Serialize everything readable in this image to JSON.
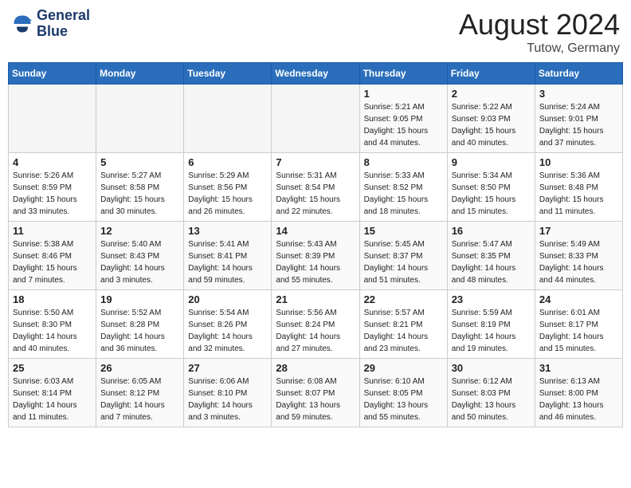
{
  "header": {
    "logo_line1": "General",
    "logo_line2": "Blue",
    "title": "August 2024",
    "subtitle": "Tutow, Germany"
  },
  "days_of_week": [
    "Sunday",
    "Monday",
    "Tuesday",
    "Wednesday",
    "Thursday",
    "Friday",
    "Saturday"
  ],
  "weeks": [
    [
      {
        "day": "",
        "sunrise": "",
        "sunset": "",
        "daylight": ""
      },
      {
        "day": "",
        "sunrise": "",
        "sunset": "",
        "daylight": ""
      },
      {
        "day": "",
        "sunrise": "",
        "sunset": "",
        "daylight": ""
      },
      {
        "day": "",
        "sunrise": "",
        "sunset": "",
        "daylight": ""
      },
      {
        "day": "1",
        "sunrise": "Sunrise: 5:21 AM",
        "sunset": "Sunset: 9:05 PM",
        "daylight": "Daylight: 15 hours and 44 minutes."
      },
      {
        "day": "2",
        "sunrise": "Sunrise: 5:22 AM",
        "sunset": "Sunset: 9:03 PM",
        "daylight": "Daylight: 15 hours and 40 minutes."
      },
      {
        "day": "3",
        "sunrise": "Sunrise: 5:24 AM",
        "sunset": "Sunset: 9:01 PM",
        "daylight": "Daylight: 15 hours and 37 minutes."
      }
    ],
    [
      {
        "day": "4",
        "sunrise": "Sunrise: 5:26 AM",
        "sunset": "Sunset: 8:59 PM",
        "daylight": "Daylight: 15 hours and 33 minutes."
      },
      {
        "day": "5",
        "sunrise": "Sunrise: 5:27 AM",
        "sunset": "Sunset: 8:58 PM",
        "daylight": "Daylight: 15 hours and 30 minutes."
      },
      {
        "day": "6",
        "sunrise": "Sunrise: 5:29 AM",
        "sunset": "Sunset: 8:56 PM",
        "daylight": "Daylight: 15 hours and 26 minutes."
      },
      {
        "day": "7",
        "sunrise": "Sunrise: 5:31 AM",
        "sunset": "Sunset: 8:54 PM",
        "daylight": "Daylight: 15 hours and 22 minutes."
      },
      {
        "day": "8",
        "sunrise": "Sunrise: 5:33 AM",
        "sunset": "Sunset: 8:52 PM",
        "daylight": "Daylight: 15 hours and 18 minutes."
      },
      {
        "day": "9",
        "sunrise": "Sunrise: 5:34 AM",
        "sunset": "Sunset: 8:50 PM",
        "daylight": "Daylight: 15 hours and 15 minutes."
      },
      {
        "day": "10",
        "sunrise": "Sunrise: 5:36 AM",
        "sunset": "Sunset: 8:48 PM",
        "daylight": "Daylight: 15 hours and 11 minutes."
      }
    ],
    [
      {
        "day": "11",
        "sunrise": "Sunrise: 5:38 AM",
        "sunset": "Sunset: 8:46 PM",
        "daylight": "Daylight: 15 hours and 7 minutes."
      },
      {
        "day": "12",
        "sunrise": "Sunrise: 5:40 AM",
        "sunset": "Sunset: 8:43 PM",
        "daylight": "Daylight: 14 hours and 3 minutes."
      },
      {
        "day": "13",
        "sunrise": "Sunrise: 5:41 AM",
        "sunset": "Sunset: 8:41 PM",
        "daylight": "Daylight: 14 hours and 59 minutes."
      },
      {
        "day": "14",
        "sunrise": "Sunrise: 5:43 AM",
        "sunset": "Sunset: 8:39 PM",
        "daylight": "Daylight: 14 hours and 55 minutes."
      },
      {
        "day": "15",
        "sunrise": "Sunrise: 5:45 AM",
        "sunset": "Sunset: 8:37 PM",
        "daylight": "Daylight: 14 hours and 51 minutes."
      },
      {
        "day": "16",
        "sunrise": "Sunrise: 5:47 AM",
        "sunset": "Sunset: 8:35 PM",
        "daylight": "Daylight: 14 hours and 48 minutes."
      },
      {
        "day": "17",
        "sunrise": "Sunrise: 5:49 AM",
        "sunset": "Sunset: 8:33 PM",
        "daylight": "Daylight: 14 hours and 44 minutes."
      }
    ],
    [
      {
        "day": "18",
        "sunrise": "Sunrise: 5:50 AM",
        "sunset": "Sunset: 8:30 PM",
        "daylight": "Daylight: 14 hours and 40 minutes."
      },
      {
        "day": "19",
        "sunrise": "Sunrise: 5:52 AM",
        "sunset": "Sunset: 8:28 PM",
        "daylight": "Daylight: 14 hours and 36 minutes."
      },
      {
        "day": "20",
        "sunrise": "Sunrise: 5:54 AM",
        "sunset": "Sunset: 8:26 PM",
        "daylight": "Daylight: 14 hours and 32 minutes."
      },
      {
        "day": "21",
        "sunrise": "Sunrise: 5:56 AM",
        "sunset": "Sunset: 8:24 PM",
        "daylight": "Daylight: 14 hours and 27 minutes."
      },
      {
        "day": "22",
        "sunrise": "Sunrise: 5:57 AM",
        "sunset": "Sunset: 8:21 PM",
        "daylight": "Daylight: 14 hours and 23 minutes."
      },
      {
        "day": "23",
        "sunrise": "Sunrise: 5:59 AM",
        "sunset": "Sunset: 8:19 PM",
        "daylight": "Daylight: 14 hours and 19 minutes."
      },
      {
        "day": "24",
        "sunrise": "Sunrise: 6:01 AM",
        "sunset": "Sunset: 8:17 PM",
        "daylight": "Daylight: 14 hours and 15 minutes."
      }
    ],
    [
      {
        "day": "25",
        "sunrise": "Sunrise: 6:03 AM",
        "sunset": "Sunset: 8:14 PM",
        "daylight": "Daylight: 14 hours and 11 minutes."
      },
      {
        "day": "26",
        "sunrise": "Sunrise: 6:05 AM",
        "sunset": "Sunset: 8:12 PM",
        "daylight": "Daylight: 14 hours and 7 minutes."
      },
      {
        "day": "27",
        "sunrise": "Sunrise: 6:06 AM",
        "sunset": "Sunset: 8:10 PM",
        "daylight": "Daylight: 14 hours and 3 minutes."
      },
      {
        "day": "28",
        "sunrise": "Sunrise: 6:08 AM",
        "sunset": "Sunset: 8:07 PM",
        "daylight": "Daylight: 13 hours and 59 minutes."
      },
      {
        "day": "29",
        "sunrise": "Sunrise: 6:10 AM",
        "sunset": "Sunset: 8:05 PM",
        "daylight": "Daylight: 13 hours and 55 minutes."
      },
      {
        "day": "30",
        "sunrise": "Sunrise: 6:12 AM",
        "sunset": "Sunset: 8:03 PM",
        "daylight": "Daylight: 13 hours and 50 minutes."
      },
      {
        "day": "31",
        "sunrise": "Sunrise: 6:13 AM",
        "sunset": "Sunset: 8:00 PM",
        "daylight": "Daylight: 13 hours and 46 minutes."
      }
    ]
  ]
}
